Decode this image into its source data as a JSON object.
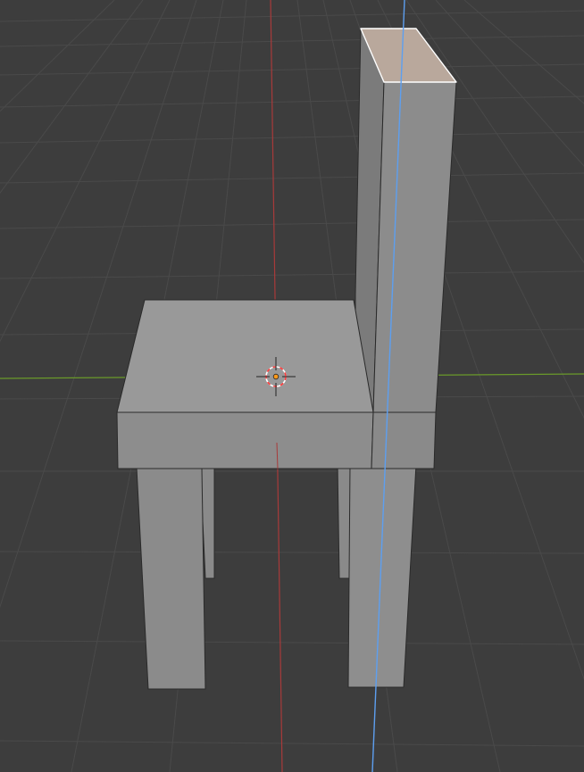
{
  "viewport": {
    "background": "#3d3d3d",
    "grid_color": "#4a4a4a",
    "x_axis_color": "#6a9a2a",
    "y_axis_color": "#a83a3a",
    "z_axis_color": "#5d9ff0"
  },
  "model": {
    "object": "chair",
    "selected_face": "backrest-top-face",
    "body_color": "#898989",
    "dark_face_color": "#7a7a7a",
    "light_face_color": "#9a9a9a",
    "selected_face_color": "#b9a89c",
    "edge_color": "#2a2a2a",
    "selected_edge_color": "#ffffff"
  },
  "cursor_3d": {
    "icon": "3d-cursor-icon",
    "ring_color_a": "#ff3b3b",
    "ring_color_b": "#ffffff",
    "origin_color": "#ff9a1a"
  }
}
